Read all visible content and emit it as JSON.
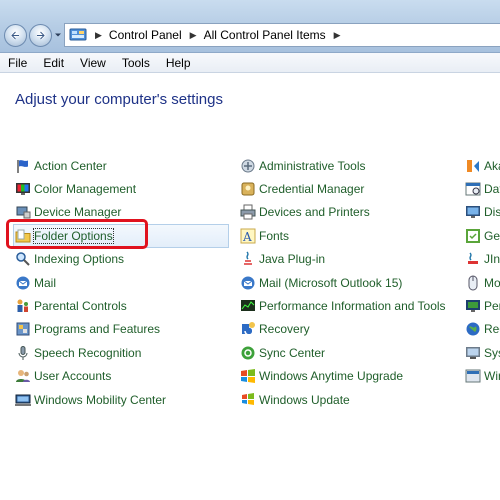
{
  "breadcrumb": [
    "Control Panel",
    "All Control Panel Items"
  ],
  "menu": [
    "File",
    "Edit",
    "View",
    "Tools",
    "Help"
  ],
  "main": {
    "title": "Adjust your computer's settings",
    "col1": [
      {
        "label": "Action Center",
        "icon": "flag-icon"
      },
      {
        "label": "Color Management",
        "icon": "monitor-color-icon"
      },
      {
        "label": "Device Manager",
        "icon": "device-manager-icon"
      },
      {
        "label": "Folder Options",
        "icon": "folder-icon"
      },
      {
        "label": "Indexing Options",
        "icon": "indexing-icon"
      },
      {
        "label": "Mail",
        "icon": "mail-icon"
      },
      {
        "label": "Parental Controls",
        "icon": "parental-controls-icon"
      },
      {
        "label": "Programs and Features",
        "icon": "programs-icon"
      },
      {
        "label": "Speech Recognition",
        "icon": "microphone-icon"
      },
      {
        "label": "User Accounts",
        "icon": "users-icon"
      },
      {
        "label": "Windows Mobility Center",
        "icon": "mobility-icon"
      }
    ],
    "col2": [
      {
        "label": "Administrative Tools",
        "icon": "admin-tools-icon"
      },
      {
        "label": "Credential Manager",
        "icon": "credential-icon"
      },
      {
        "label": "Devices and Printers",
        "icon": "printer-icon"
      },
      {
        "label": "Fonts",
        "icon": "fonts-icon"
      },
      {
        "label": "Java Plug-in",
        "icon": "java-icon"
      },
      {
        "label": "Mail (Microsoft Outlook 15)",
        "icon": "mail-icon"
      },
      {
        "label": "Performance Information and Tools",
        "icon": "performance-icon"
      },
      {
        "label": "Recovery",
        "icon": "recovery-icon"
      },
      {
        "label": "Sync Center",
        "icon": "sync-icon"
      },
      {
        "label": "Windows Anytime Upgrade",
        "icon": "windows-logo-icon"
      },
      {
        "label": "Windows Update",
        "icon": "windows-update-icon"
      }
    ],
    "col3": [
      {
        "label": "Aka",
        "icon": "aka-icon"
      },
      {
        "label": "Dat",
        "icon": "date-time-icon"
      },
      {
        "label": "Disp",
        "icon": "display-icon"
      },
      {
        "label": "Get",
        "icon": "getting-started-icon"
      },
      {
        "label": "JIni",
        "icon": "jinitiator-icon"
      },
      {
        "label": "Mo",
        "icon": "mouse-icon"
      },
      {
        "label": "Per",
        "icon": "personalization-icon"
      },
      {
        "label": "Reg",
        "icon": "region-icon"
      },
      {
        "label": "Sys",
        "icon": "system-icon"
      },
      {
        "label": "Wir",
        "icon": "windows-defender-icon"
      }
    ]
  },
  "selected_item": "Folder Options",
  "colors": {
    "link": "#1f5e2a",
    "title": "#1e3287",
    "highlight": "#e0121e"
  }
}
